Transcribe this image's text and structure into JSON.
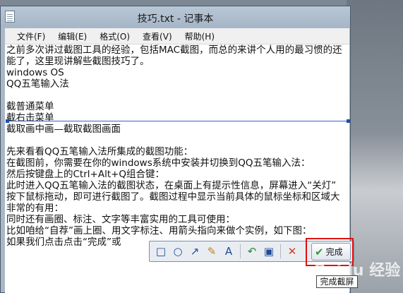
{
  "window": {
    "title": "技巧.txt - 记事本"
  },
  "menu": [
    {
      "label": "文件(F)"
    },
    {
      "label": "编辑(E)"
    },
    {
      "label": "格式(O)"
    },
    {
      "label": "查看(V)"
    },
    {
      "label": "帮助(H)"
    }
  ],
  "content_lines": [
    "之前多次讲过截图工具的经验，包括MAC截图，而总的来讲个人用的最习惯的还",
    "能了，这里现讲解些截图技巧了。",
    "windows OS",
    "QQ五笔输入法",
    "",
    "截普通菜单",
    "截右击菜单",
    "截取画中画—截取截图画面",
    "",
    "先来看看QQ五笔输入法所集成的截图功能：",
    "在截图前，你需要在你的windows系统中安装并切换到QQ五笔输入法：",
    "然后按键盘上的Ctrl+Alt+Q组合键：",
    "此时进入QQ五笔输入法的截图状态，在桌面上有提示性信息，屏幕进入“关灯”",
    "按下鼠标拖动，即可进行截图了。截图过程中显示当前具体的鼠标坐标和区域大",
    "非常的有用：",
    "同时还有画圈、标注、文字等丰富实用的工具可使用：",
    "比如咱给“自荐”画上圈、用文字标注、用箭头指向来做个实例，如下图：",
    "如果我们点击点击“完成”或",
    ""
  ],
  "toolbar": {
    "tools": [
      {
        "icon": "rectangle-icon",
        "glyph": "□"
      },
      {
        "icon": "ellipse-icon",
        "glyph": "○"
      },
      {
        "icon": "arrow-icon",
        "glyph": "↗"
      },
      {
        "icon": "brush-icon",
        "glyph": "✎"
      },
      {
        "icon": "text-icon",
        "glyph": "A"
      },
      {
        "icon": "undo-icon",
        "glyph": "↶"
      },
      {
        "icon": "save-icon",
        "glyph": "▣"
      },
      {
        "icon": "cancel-icon",
        "glyph": "✕"
      }
    ],
    "done_label": "完成"
  },
  "tooltip": "完成截屏",
  "watermark": "Baidu 经验",
  "colors": {
    "highlight_box": "#e01010",
    "done_check": "#2ea02e"
  }
}
